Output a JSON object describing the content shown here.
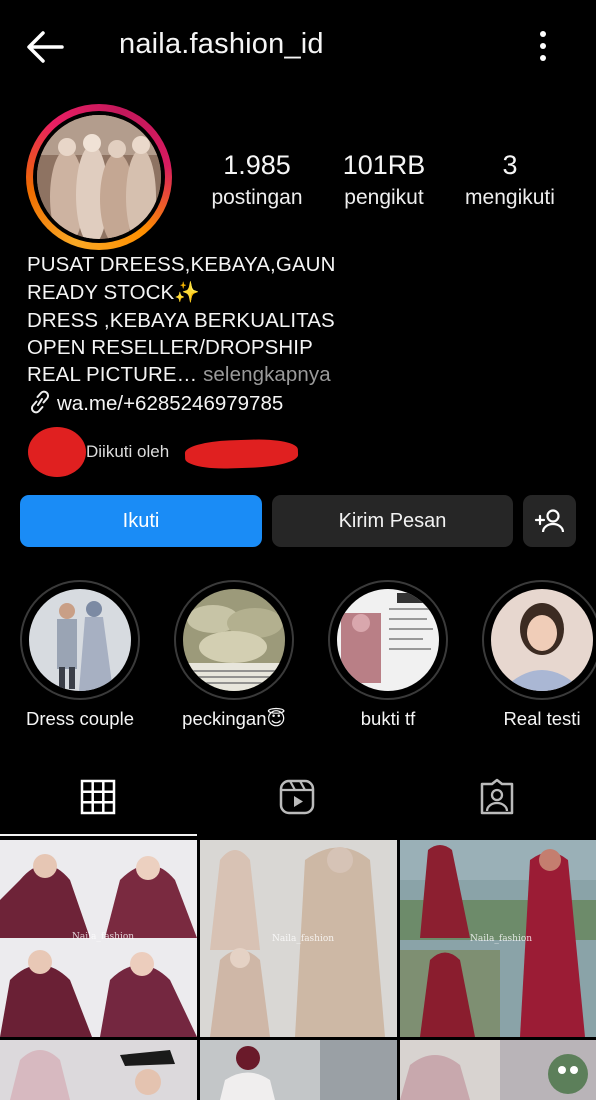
{
  "header": {
    "username": "naila.fashion_id",
    "back_icon": "arrow-left-icon",
    "menu_icon": "more-vertical-icon"
  },
  "stats": [
    {
      "value": "1.985",
      "label": "postingan"
    },
    {
      "value": "101RB",
      "label": "pengikut"
    },
    {
      "value": "3",
      "label": "mengikuti"
    }
  ],
  "bio": {
    "line1": "PUSAT DREESS,KEBAYA,GAUN",
    "line2": "READY STOCK✨",
    "line3": "DRESS ,KEBAYA BERKUALITAS",
    "line4": "OPEN RESELLER/DROPSHIP",
    "line5": "REAL PICTURE…",
    "more": "selengkapnya",
    "link": "wa.me/+6285246979785",
    "followed_by": "Diikuti oleh"
  },
  "actions": {
    "follow": "Ikuti",
    "message": "Kirim Pesan",
    "add_user_icon": "add-person-icon"
  },
  "highlights": [
    {
      "label": "Dress couple"
    },
    {
      "label": "peckingan😇"
    },
    {
      "label": "bukti tf"
    },
    {
      "label": "Real testi"
    }
  ],
  "tabs": [
    {
      "name": "grid",
      "icon": "grid-icon",
      "active": true
    },
    {
      "name": "reels",
      "icon": "reels-icon",
      "active": false
    },
    {
      "name": "tagged",
      "icon": "tagged-user-icon",
      "active": false
    }
  ],
  "watermarks": {
    "cell1": "Naila_fashion",
    "cell2": "Naila_fashion",
    "cell3": "Naila_fashion"
  },
  "colors": {
    "accent": "#1a8cf6",
    "secondary_button": "#262626",
    "background": "#000000",
    "muted_text": "#9a9a9a"
  }
}
